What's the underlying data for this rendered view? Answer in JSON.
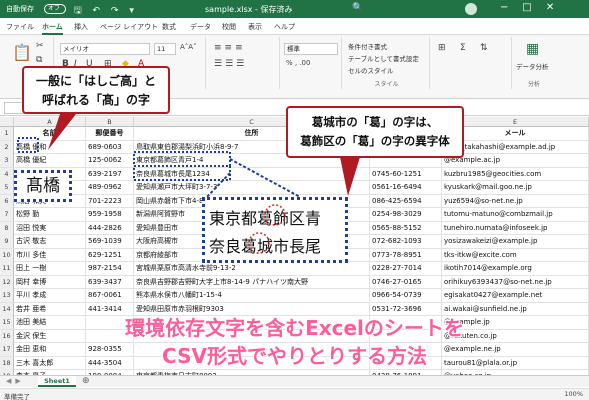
{
  "titlebar": {
    "autosave": "自動保存",
    "toggle": "オフ",
    "quick_icons": "🖫 ↶ ↷ ▾",
    "title": "sample.xlsx - 保存済み",
    "search": "🔍"
  },
  "tabs": [
    "ファイル",
    "ホーム",
    "挿入",
    "ページ レイアウト",
    "数式",
    "データ",
    "校閲",
    "表示",
    "ヘルプ"
  ],
  "ribbon": {
    "font_name": "メイリオ",
    "font_size": "11",
    "number_format": "標準",
    "cond_format": "条件付き書式",
    "table_format": "テーブルとして書式設定",
    "cell_style": "セルのスタイル",
    "group_style": "スタイル",
    "analyze": "データ分析",
    "group_analyze": "分析"
  },
  "columns": [
    "A",
    "B",
    "C",
    "D",
    "E"
  ],
  "header_row": [
    "名前",
    "郵便番号",
    "住所",
    "",
    "メール"
  ],
  "rows": [
    [
      "高橋 優和",
      "689-0603",
      "鳥取県東伯郡湯梨浜町小浜8-9-7",
      "",
      "saori_takahashi@example.ad.jp"
    ],
    [
      "高橋 優紀",
      "125-0062",
      "東京都葛飾区青戸1-4",
      "",
      "@example.ac.jp"
    ],
    [
      "",
      "639-2197",
      "奈良県葛城市長尾1234",
      "0745-60-1251",
      "kuzbru1985@geocities.com"
    ],
    [
      "",
      "489-0962",
      "愛知県瀬戸市大坪町3-7-3",
      "0561-16-6494",
      "kyuskark@mail.goo.ne.jp"
    ],
    [
      "鳥居 和夫",
      "701-2223",
      "岡山県赤磐市下市4-8-5",
      "086-425-6594",
      "yuz6594@so-net.ne.jp"
    ],
    [
      "松野 勤",
      "959-1958",
      "新潟県阿賀野市",
      "0254-98-3029",
      "tutomu-matuno@combzmail.jp"
    ],
    [
      "沼田 悦実",
      "444-2826",
      "愛知県豊田市",
      "0565-88-5152",
      "tunehiro.numata@infoseek.jp"
    ],
    [
      "古沢 敬志",
      "569-1039",
      "大阪府高槻市",
      "072-682-1093",
      "yosizawakeizi@example.jp"
    ],
    [
      "市川 多佳",
      "629-1251",
      "京都府綾部市",
      "0773-78-8951",
      "tks-itkw@excite.com"
    ],
    [
      "田上 一樹",
      "987-2154",
      "宮城県栗原市高清水寺前9-13-2",
      "0228-27-7014",
      "ikotih7014@example.org"
    ],
    [
      "岡村 幸博",
      "639-3437",
      "奈良県吉野郡吉野町大字上市8-14-9 パナハイツ南大野",
      "0746-27-0165",
      "orihikuy6393437@so-net.ne.jp"
    ],
    [
      "平川 孝成",
      "867-0061",
      "熊本県水俣市八幡町1-15-4",
      "0966-54-0739",
      "egisakat0427@example.net"
    ],
    [
      "若井 亜希",
      "441-3414",
      "愛知県田原市赤羽根町9303",
      "0531-72-3696",
      "ai.wakai@sunfield.ne.jp"
    ],
    [
      "池田 美結",
      "",
      "",
      "",
      "@example.jp"
    ],
    [
      "金沢 保生",
      "",
      "",
      "",
      "@rakuten.co.jp"
    ],
    [
      "金田 恵和",
      "928-0355",
      "",
      "",
      "@example.ne.jp"
    ],
    [
      "三木 喜太郎",
      "444-3504",
      "",
      "",
      "taurou81@plala.or.jp"
    ],
    [
      "森本 夏子",
      "198-0084",
      "東京都青梅市日吉町8092",
      "0428-76-1991",
      "@yahoo.co.jp"
    ]
  ],
  "row_numbers": [
    "1",
    "2",
    "3",
    "4",
    "5",
    "6",
    "7",
    "8",
    "9",
    "10",
    "11",
    "12",
    "13",
    "14",
    "15",
    "16",
    "17",
    "18",
    "19"
  ],
  "callout_left": {
    "line1": "一般に「はしご高」と",
    "line2": "呼ばれる「髙」の字"
  },
  "callout_right": {
    "line1": "葛城市の「葛」の字は、",
    "line2": "葛飾区の「葛」の字の異字体"
  },
  "big_name": "髙橋",
  "zoom_lines": [
    "東京都葛飾区青",
    "奈良葛城市長尾"
  ],
  "headline": {
    "line1": "環境依存文字を含むExcelのシートを",
    "line2": "CSV形式でやりとりする方法"
  },
  "sheet_tab": "Sheet1",
  "status": "準備完了",
  "zoom": "100%",
  "colors": {
    "accent": "#217346",
    "callout_border": "#b01a22",
    "dotted": "#1c3f9a",
    "headline": "#ff5c9a"
  }
}
